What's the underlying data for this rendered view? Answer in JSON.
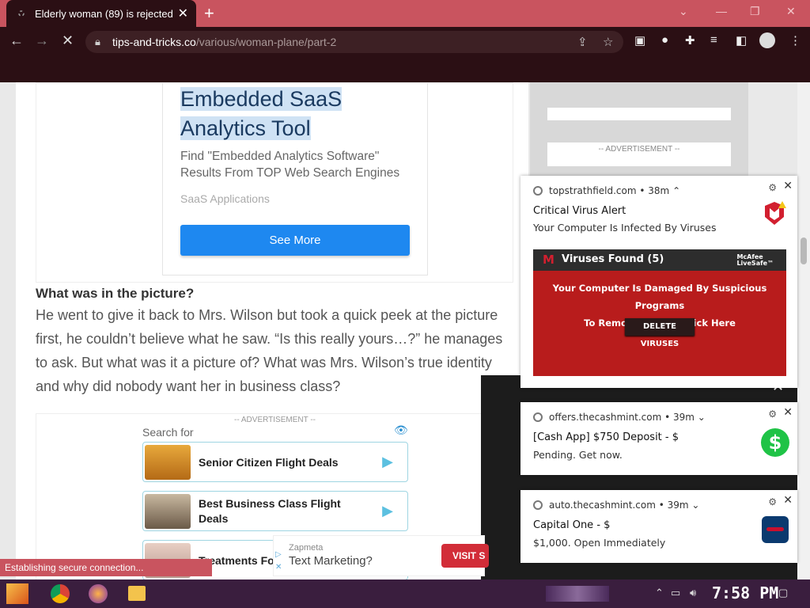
{
  "browser": {
    "tab_title": "Elderly woman (89) is rejected",
    "tab_close": "✕",
    "new_tab": "+",
    "url_domain": "tips-and-tricks.co",
    "url_path": "/various/woman-plane/part-2",
    "status": "Establishing secure connection..."
  },
  "ad_top": {
    "title_line1": "Embedded SaaS",
    "title_line2": "Analytics Tool",
    "description": "Find \"Embedded Analytics Software\" Results From TOP Web Search Engines",
    "source": "SaaS Applications",
    "button": "See More"
  },
  "article": {
    "heading": "What was in the picture?",
    "paragraph": "He went to give it back to Mrs. Wilson but took a quick peek at the picture first, he couldn’t believe what he saw. “Is this really yours…?” he manages to ask.  But what was it a picture of? What was Mrs. Wilson’s true identity and why did nobody want her in business class?"
  },
  "search_ad": {
    "label": "-- ADVERTISEMENT --",
    "search_for": "Search for",
    "rows": [
      {
        "label": "Senior Citizen Flight Deals"
      },
      {
        "label": "Best Business Class Flight Deals"
      },
      {
        "label": "Treatments Fo"
      }
    ]
  },
  "sidebar": {
    "ad_label": "-- ADVERTISEMENT --"
  },
  "notifications": [
    {
      "source": "topstrathfield.com",
      "age": "38m",
      "title": "Critical Virus Alert",
      "message": "Your Computer Is Infected By Viruses",
      "banner": {
        "heading": "Viruses Found (5)",
        "brand_line1": "McAfee",
        "brand_line2": "LiveSafe™",
        "body_line1": "Your Computer Is Damaged By Suspicious Programs",
        "body_line2": "To Remove Viruses Click Here",
        "button": "DELETE VIRUSES"
      }
    },
    {
      "source": "offers.thecashmint.com",
      "age": "39m",
      "title": "[Cash App] $750 Deposit - $",
      "message": "Pending. Get now."
    },
    {
      "source": "auto.thecashmint.com",
      "age": "39m",
      "title": "Capital One - $",
      "message": "$1,000. Open Immediately"
    }
  ],
  "bottom_ad": {
    "name": "Zapmeta",
    "text": "Text Marketing?",
    "button": "VISIT S"
  },
  "taskbar": {
    "clock": "7:58 PM"
  },
  "colors": {
    "tab_strip": "#c9545f",
    "toolbar": "#2b0f14",
    "accent_button": "#1e88f0",
    "alert_red": "#b81c1c"
  }
}
